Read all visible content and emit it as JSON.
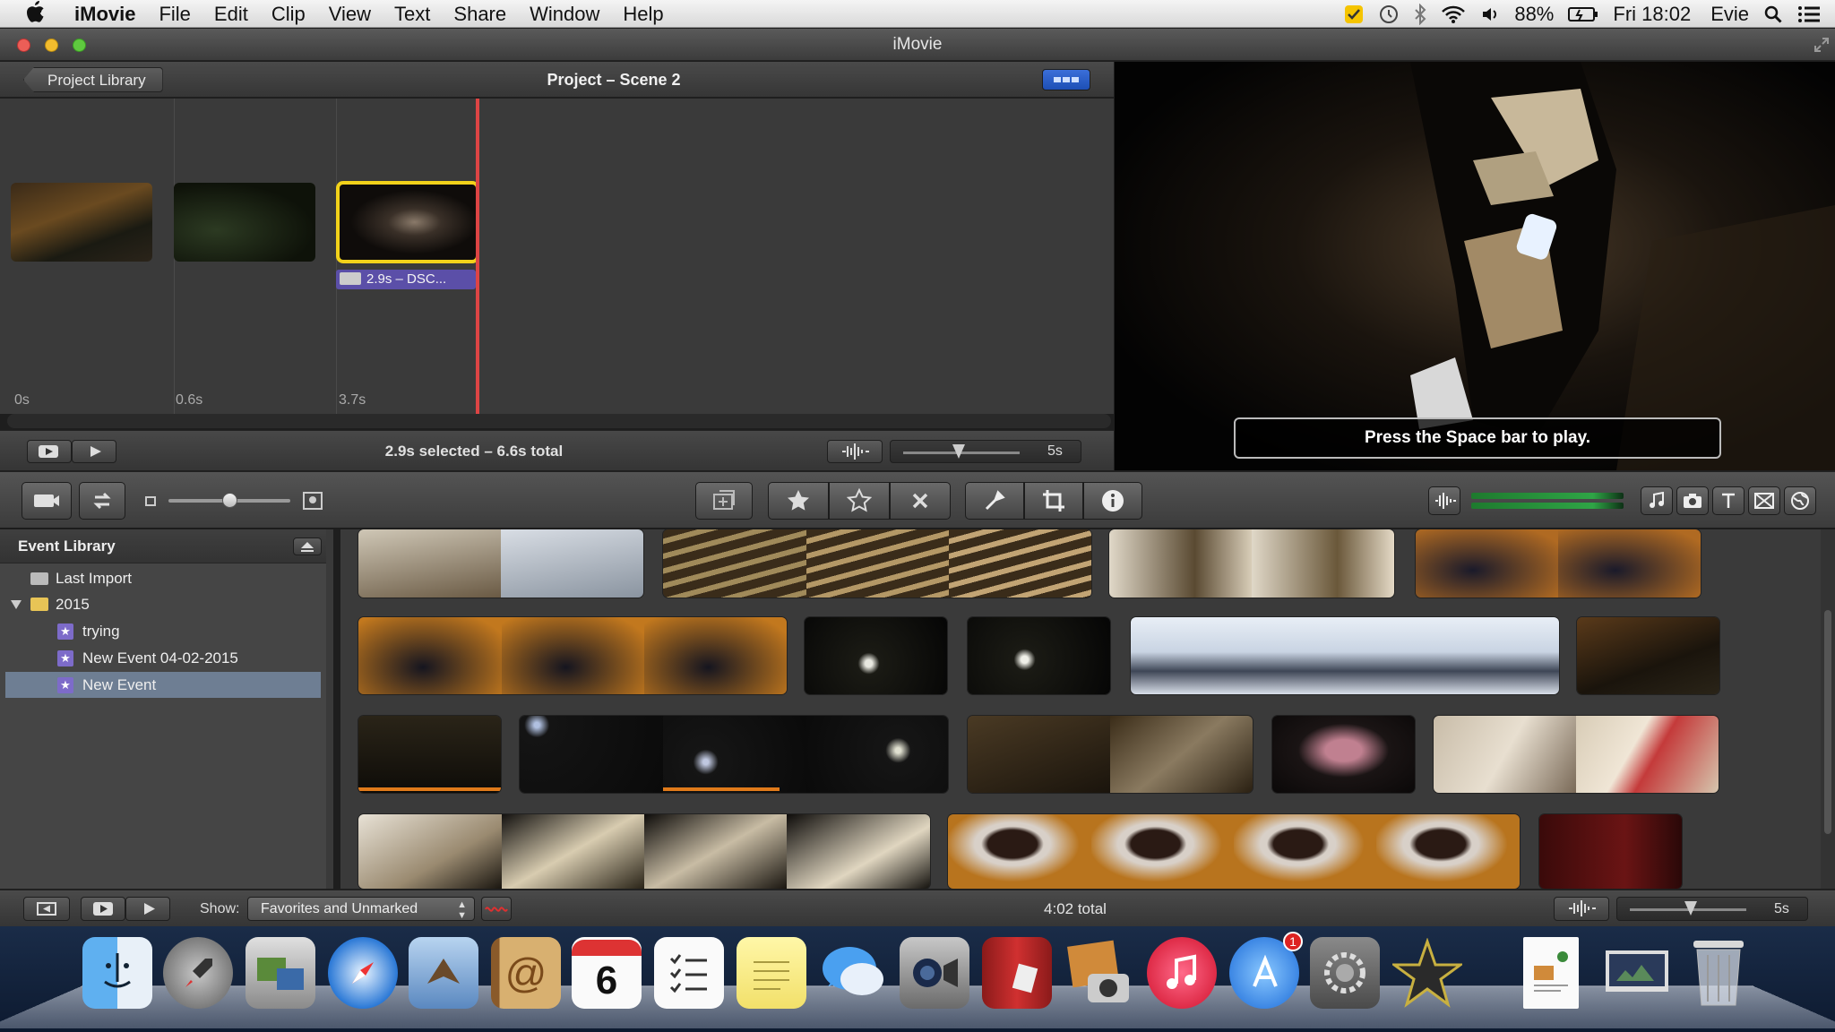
{
  "menubar": {
    "app": "iMovie",
    "items": [
      "File",
      "Edit",
      "Clip",
      "View",
      "Text",
      "Share",
      "Window",
      "Help"
    ],
    "battery": "88%",
    "time": "Fri 18:02",
    "user": "Evie"
  },
  "window": {
    "title": "iMovie"
  },
  "project": {
    "back_label": "Project Library",
    "title": "Project – Scene 2",
    "clip_label": "2.9s – DSC...",
    "ticks": [
      "0s",
      "0.6s",
      "3.7s"
    ],
    "selection": "2.9s selected – 6.6s total",
    "zoom_label": "5s"
  },
  "viewer": {
    "hint": "Press the Space bar to play."
  },
  "event_library": {
    "title": "Event Library",
    "items": [
      {
        "label": "Last Import"
      },
      {
        "label": "2015"
      },
      {
        "label": "trying"
      },
      {
        "label": "New Event 04-02-2015"
      },
      {
        "label": "New Event"
      }
    ]
  },
  "bottom": {
    "show_label": "Show:",
    "show_value": "Favorites and Unmarked",
    "total": "4:02 total",
    "zoom_label": "5s"
  },
  "colors": {
    "selection_yellow": "#f2d21a",
    "playhead_red": "#d44",
    "row_selected": "#6e7e93",
    "favorite_green": "#2e8b3a",
    "clip_purple": "#5b4fa8"
  },
  "icons": [
    "apple-icon",
    "checkmark-icon",
    "time-machine-icon",
    "bluetooth-icon",
    "wifi-icon",
    "volume-icon",
    "battery-icon",
    "spotlight-icon",
    "list-icon"
  ]
}
